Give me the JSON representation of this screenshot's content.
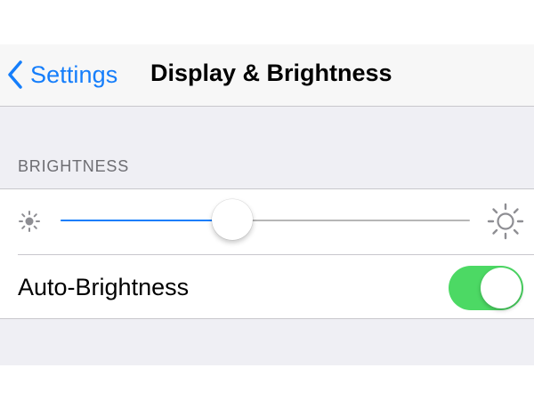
{
  "navbar": {
    "back_label": "Settings",
    "back_icon": "chevron-left-icon",
    "title": "Display & Brightness"
  },
  "brightness_section": {
    "header": "BRIGHTNESS",
    "slider": {
      "value": 0.42,
      "min_icon": "sun-small-icon",
      "max_icon": "sun-large-icon"
    },
    "auto_brightness": {
      "label": "Auto-Brightness",
      "enabled": true
    }
  },
  "colors": {
    "accent": "#157efb",
    "toggle_on": "#4cd964",
    "background": "#efeff4",
    "section_header": "#6d6d72"
  }
}
